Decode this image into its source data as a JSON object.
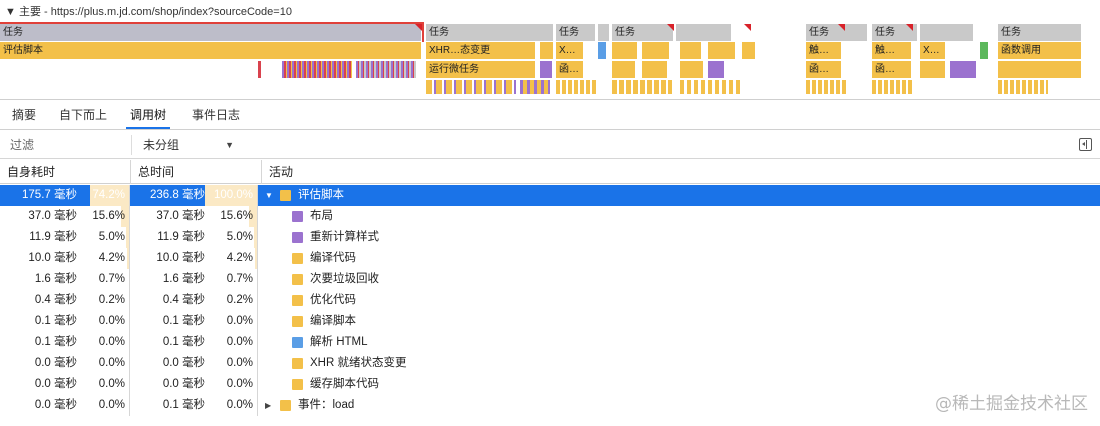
{
  "flame": {
    "thread_label": "▼ 主要 - https://plus.m.jd.com/shop/index?sourceCode=10",
    "tasks": [
      "任务",
      "任务",
      "任务",
      "任务",
      "任务",
      "任务",
      "任务",
      "任务"
    ],
    "blocks": {
      "eval_script": "评估脚本",
      "xhr_state": "XHR…态变更",
      "x1": "X…",
      "x2": "X…",
      "fn_call": "函数调用",
      "touch1": "触…",
      "touch2": "触…",
      "run_micro": "运行微任务",
      "han1": "函…",
      "han2": "函…",
      "han3": "函…"
    }
  },
  "tabs": {
    "items": [
      "摘要",
      "自下而上",
      "调用树",
      "事件日志"
    ],
    "active": "调用树"
  },
  "filter": {
    "placeholder": "过滤",
    "group_value": "未分组"
  },
  "table": {
    "headers": {
      "self": "自身耗时",
      "total": "总时间",
      "activity": "活动"
    },
    "rows": [
      {
        "self_ms": "175.7 毫秒",
        "self_pct": "74.2%",
        "self_frac": 0.742,
        "total_ms": "236.8 毫秒",
        "total_pct": "100.0%",
        "total_frac": 1.0,
        "activity": "评估脚本",
        "color": "#f3c049",
        "expander": "▼",
        "selected": true
      },
      {
        "self_ms": "37.0 毫秒",
        "self_pct": "15.6%",
        "self_frac": 0.156,
        "total_ms": "37.0 毫秒",
        "total_pct": "15.6%",
        "total_frac": 0.156,
        "activity": "布局",
        "color": "#9b72cf",
        "expander": "",
        "selected": false
      },
      {
        "self_ms": "11.9 毫秒",
        "self_pct": "5.0%",
        "self_frac": 0.05,
        "total_ms": "11.9 毫秒",
        "total_pct": "5.0%",
        "total_frac": 0.05,
        "activity": "重新计算样式",
        "color": "#9b72cf",
        "expander": "",
        "selected": false
      },
      {
        "self_ms": "10.0 毫秒",
        "self_pct": "4.2%",
        "self_frac": 0.042,
        "total_ms": "10.0 毫秒",
        "total_pct": "4.2%",
        "total_frac": 0.042,
        "activity": "编译代码",
        "color": "#f3c049",
        "expander": "",
        "selected": false
      },
      {
        "self_ms": "1.6 毫秒",
        "self_pct": "0.7%",
        "self_frac": 0.007,
        "total_ms": "1.6 毫秒",
        "total_pct": "0.7%",
        "total_frac": 0.007,
        "activity": "次要垃圾回收",
        "color": "#f3c049",
        "expander": "",
        "selected": false
      },
      {
        "self_ms": "0.4 毫秒",
        "self_pct": "0.2%",
        "self_frac": 0.002,
        "total_ms": "0.4 毫秒",
        "total_pct": "0.2%",
        "total_frac": 0.002,
        "activity": "优化代码",
        "color": "#f3c049",
        "expander": "",
        "selected": false
      },
      {
        "self_ms": "0.1 毫秒",
        "self_pct": "0.0%",
        "self_frac": 0,
        "total_ms": "0.1 毫秒",
        "total_pct": "0.0%",
        "total_frac": 0,
        "activity": "编译脚本",
        "color": "#f3c049",
        "expander": "",
        "selected": false
      },
      {
        "self_ms": "0.1 毫秒",
        "self_pct": "0.0%",
        "self_frac": 0,
        "total_ms": "0.1 毫秒",
        "total_pct": "0.0%",
        "total_frac": 0,
        "activity": "解析 HTML",
        "color": "#5a9ee6",
        "expander": "",
        "selected": false
      },
      {
        "self_ms": "0.0 毫秒",
        "self_pct": "0.0%",
        "self_frac": 0,
        "total_ms": "0.0 毫秒",
        "total_pct": "0.0%",
        "total_frac": 0,
        "activity": "XHR 就绪状态变更",
        "color": "#f3c049",
        "expander": "",
        "selected": false
      },
      {
        "self_ms": "0.0 毫秒",
        "self_pct": "0.0%",
        "self_frac": 0,
        "total_ms": "0.0 毫秒",
        "total_pct": "0.0%",
        "total_frac": 0,
        "activity": "缓存脚本代码",
        "color": "#f3c049",
        "expander": "",
        "selected": false
      },
      {
        "self_ms": "0.0 毫秒",
        "self_pct": "0.0%",
        "self_frac": 0,
        "total_ms": "0.1 毫秒",
        "total_pct": "0.0%",
        "total_frac": 0,
        "activity": "事件：load",
        "color": "#f3c049",
        "expander": "▶",
        "selected": false
      }
    ]
  },
  "watermark": "@稀土掘金技术社区"
}
